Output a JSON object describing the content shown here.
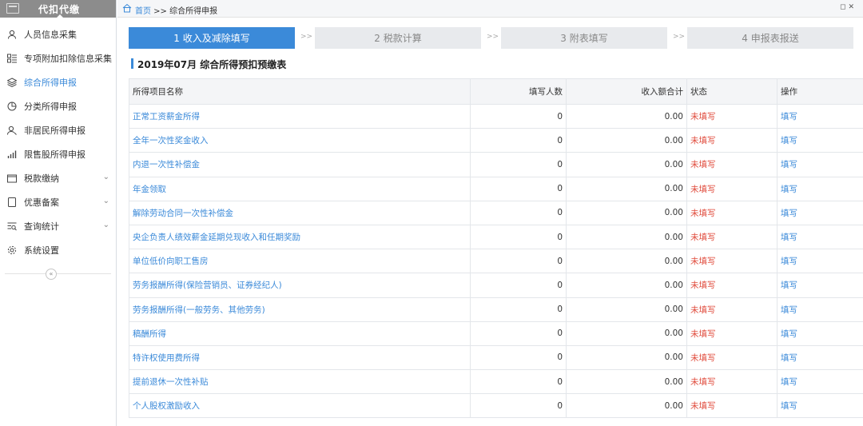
{
  "sidebar": {
    "title": "代扣代缴",
    "items": [
      {
        "label": "人员信息采集",
        "icon": "person"
      },
      {
        "label": "专项附加扣除信息采集",
        "icon": "list"
      },
      {
        "label": "综合所得申报",
        "icon": "layers"
      },
      {
        "label": "分类所得申报",
        "icon": "pie"
      },
      {
        "label": "非居民所得申报",
        "icon": "person"
      },
      {
        "label": "限售股所得申报",
        "icon": "bar"
      },
      {
        "label": "税款缴纳",
        "icon": "folder"
      },
      {
        "label": "优惠备案",
        "icon": "doc"
      },
      {
        "label": "查询统计",
        "icon": "query"
      },
      {
        "label": "系统设置",
        "icon": "gear"
      }
    ],
    "collapse_glyph": "«"
  },
  "breadcrumb": {
    "home": "首页",
    "separator": " >> ",
    "current": "综合所得申报"
  },
  "steps": [
    {
      "label": "1 收入及减除填写",
      "active": true
    },
    {
      "label": "2 税款计算",
      "active": false
    },
    {
      "label": "3 附表填写",
      "active": false
    },
    {
      "label": "4 申报表报送",
      "active": false
    }
  ],
  "step_separator": ">>",
  "section_title": "2019年07月  综合所得预扣预缴表",
  "table": {
    "headers": [
      "所得项目名称",
      "填写人数",
      "收入额合计",
      "状态",
      "操作"
    ],
    "rows": [
      {
        "name": "正常工资薪金所得",
        "count": "0",
        "income": "0.00",
        "status": "未填写",
        "op": "填写"
      },
      {
        "name": "全年一次性奖金收入",
        "count": "0",
        "income": "0.00",
        "status": "未填写",
        "op": "填写"
      },
      {
        "name": "内退一次性补偿金",
        "count": "0",
        "income": "0.00",
        "status": "未填写",
        "op": "填写"
      },
      {
        "name": "年金领取",
        "count": "0",
        "income": "0.00",
        "status": "未填写",
        "op": "填写"
      },
      {
        "name": "解除劳动合同一次性补偿金",
        "count": "0",
        "income": "0.00",
        "status": "未填写",
        "op": "填写"
      },
      {
        "name": "央企负责人绩效薪金延期兑现收入和任期奖励",
        "count": "0",
        "income": "0.00",
        "status": "未填写",
        "op": "填写"
      },
      {
        "name": "单位低价向职工售房",
        "count": "0",
        "income": "0.00",
        "status": "未填写",
        "op": "填写"
      },
      {
        "name": "劳务报酬所得(保险营销员、证券经纪人)",
        "count": "0",
        "income": "0.00",
        "status": "未填写",
        "op": "填写"
      },
      {
        "name": "劳务报酬所得(一般劳务、其他劳务)",
        "count": "0",
        "income": "0.00",
        "status": "未填写",
        "op": "填写"
      },
      {
        "name": "稿酬所得",
        "count": "0",
        "income": "0.00",
        "status": "未填写",
        "op": "填写"
      },
      {
        "name": "特许权使用费所得",
        "count": "0",
        "income": "0.00",
        "status": "未填写",
        "op": "填写"
      },
      {
        "name": "提前退休一次性补贴",
        "count": "0",
        "income": "0.00",
        "status": "未填写",
        "op": "填写"
      },
      {
        "name": "个人股权激励收入",
        "count": "0",
        "income": "0.00",
        "status": "未填写",
        "op": "填写"
      }
    ]
  },
  "colors": {
    "accent": "#3b8ad9",
    "status_red": "#e04b3c",
    "sidebar_header": "#8c8c8c"
  }
}
